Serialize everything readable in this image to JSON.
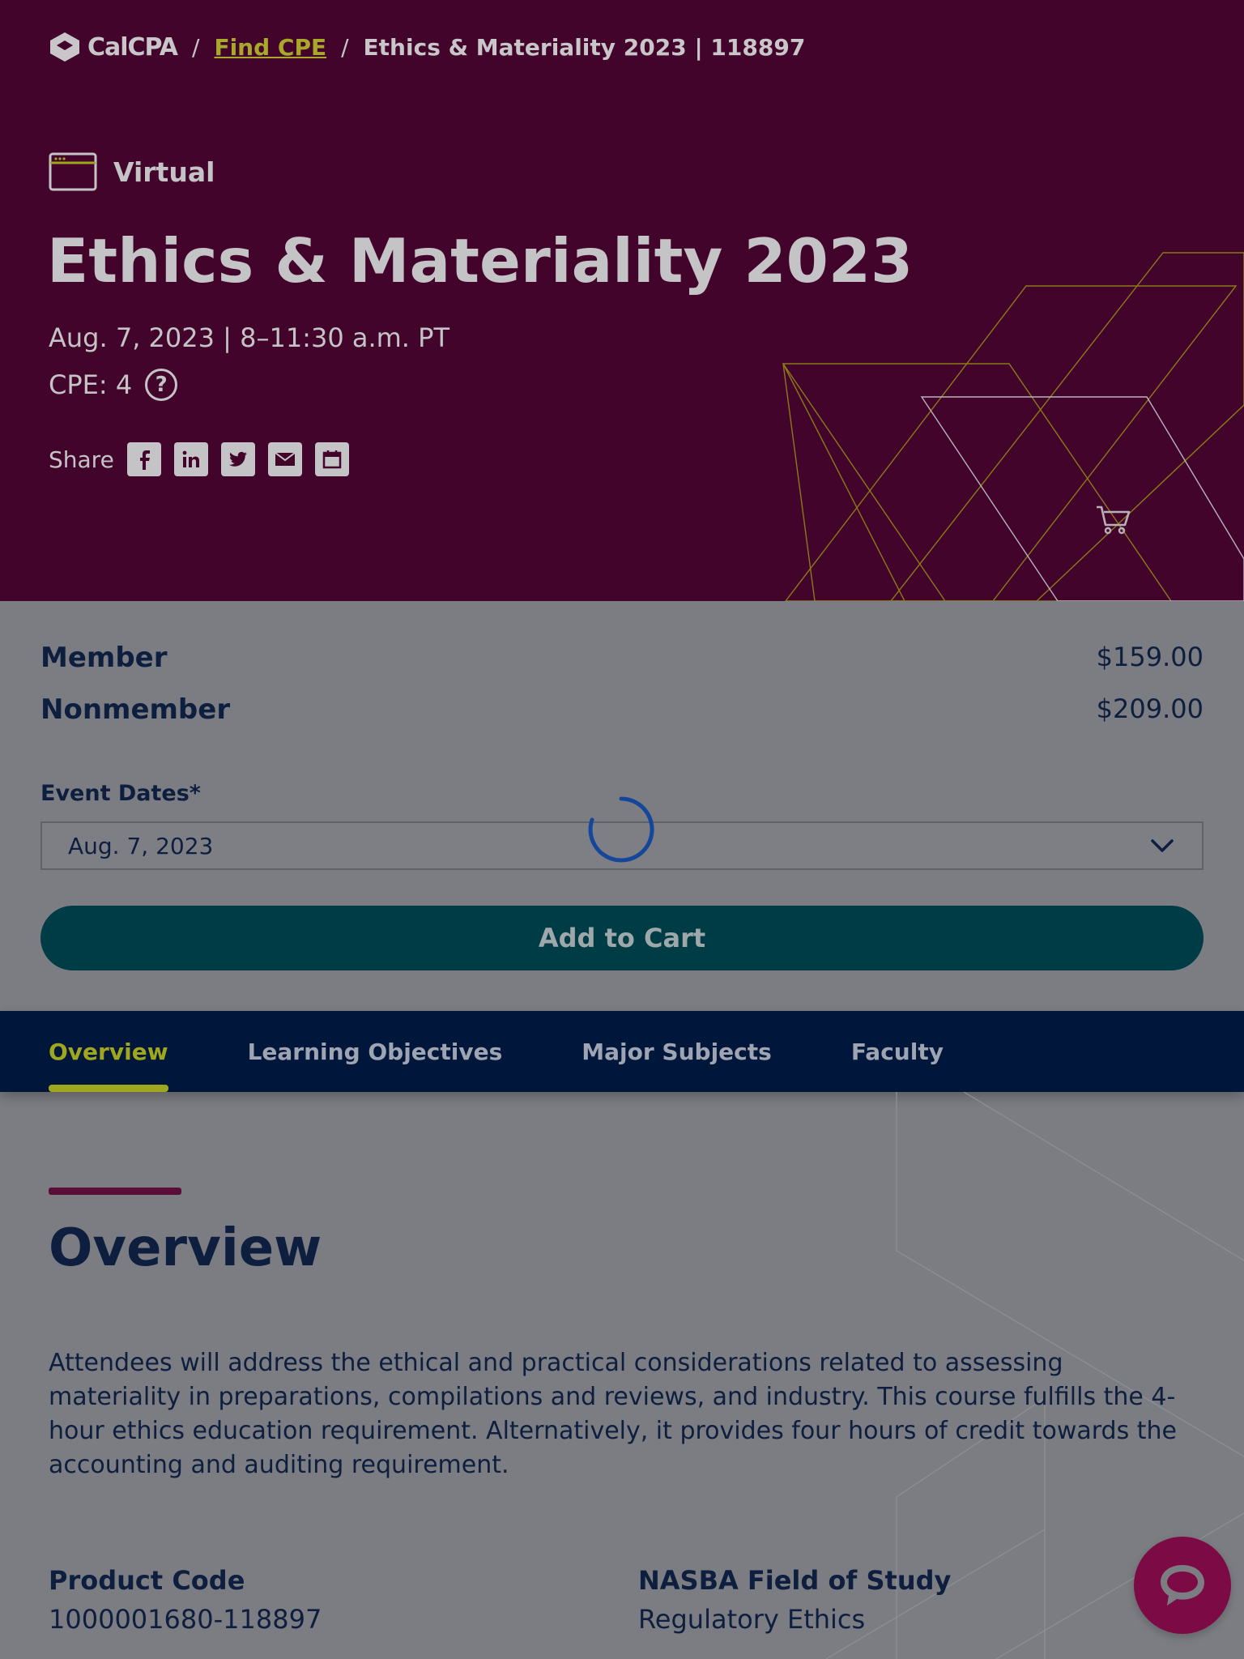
{
  "breadcrumb": {
    "logo_text": "CalCPA",
    "link": "Find CPE",
    "current": "Ethics & Materiality 2023 | 118897",
    "separator": "/"
  },
  "event": {
    "modality": "Virtual",
    "title": "Ethics & Materiality 2023",
    "date_time": "Aug. 7, 2023 | 8–11:30 a.m. PT",
    "cpe": "CPE: 4",
    "help_glyph": "?",
    "share_label": "Share",
    "share_icons": [
      "facebook-icon",
      "linkedin-icon",
      "twitter-icon",
      "email-icon",
      "calendar-icon"
    ]
  },
  "pricing": {
    "member_label": "Member",
    "member_price": "$159.00",
    "nonmember_label": "Nonmember",
    "nonmember_price": "$209.00",
    "event_dates_label": "Event Dates*",
    "selected_date": "Aug. 7, 2023",
    "add_to_cart": "Add to Cart"
  },
  "tabs": [
    {
      "label": "Overview",
      "active": true
    },
    {
      "label": "Learning Objectives",
      "active": false
    },
    {
      "label": "Major Subjects",
      "active": false
    },
    {
      "label": "Faculty",
      "active": false
    }
  ],
  "overview": {
    "heading": "Overview",
    "text": "Attendees will address the ethical and practical considerations related to assessing materiality in preparations, compilations and reviews, and industry. This course fulfills the 4-hour ethics education requirement. Alternatively, it provides four hours of credit towards the accounting and auditing requirement.",
    "product_code_label": "Product Code",
    "product_code": "1000001680-118897",
    "field_label": "NASBA Field of Study",
    "field_value": "Regulatory Ethics"
  },
  "colors": {
    "hero_bg": "#43042b",
    "accent_yellow": "#a0a61e",
    "nav_bg": "#00163a",
    "button_teal": "#003c45",
    "chat_magenta": "#7c0a45"
  }
}
